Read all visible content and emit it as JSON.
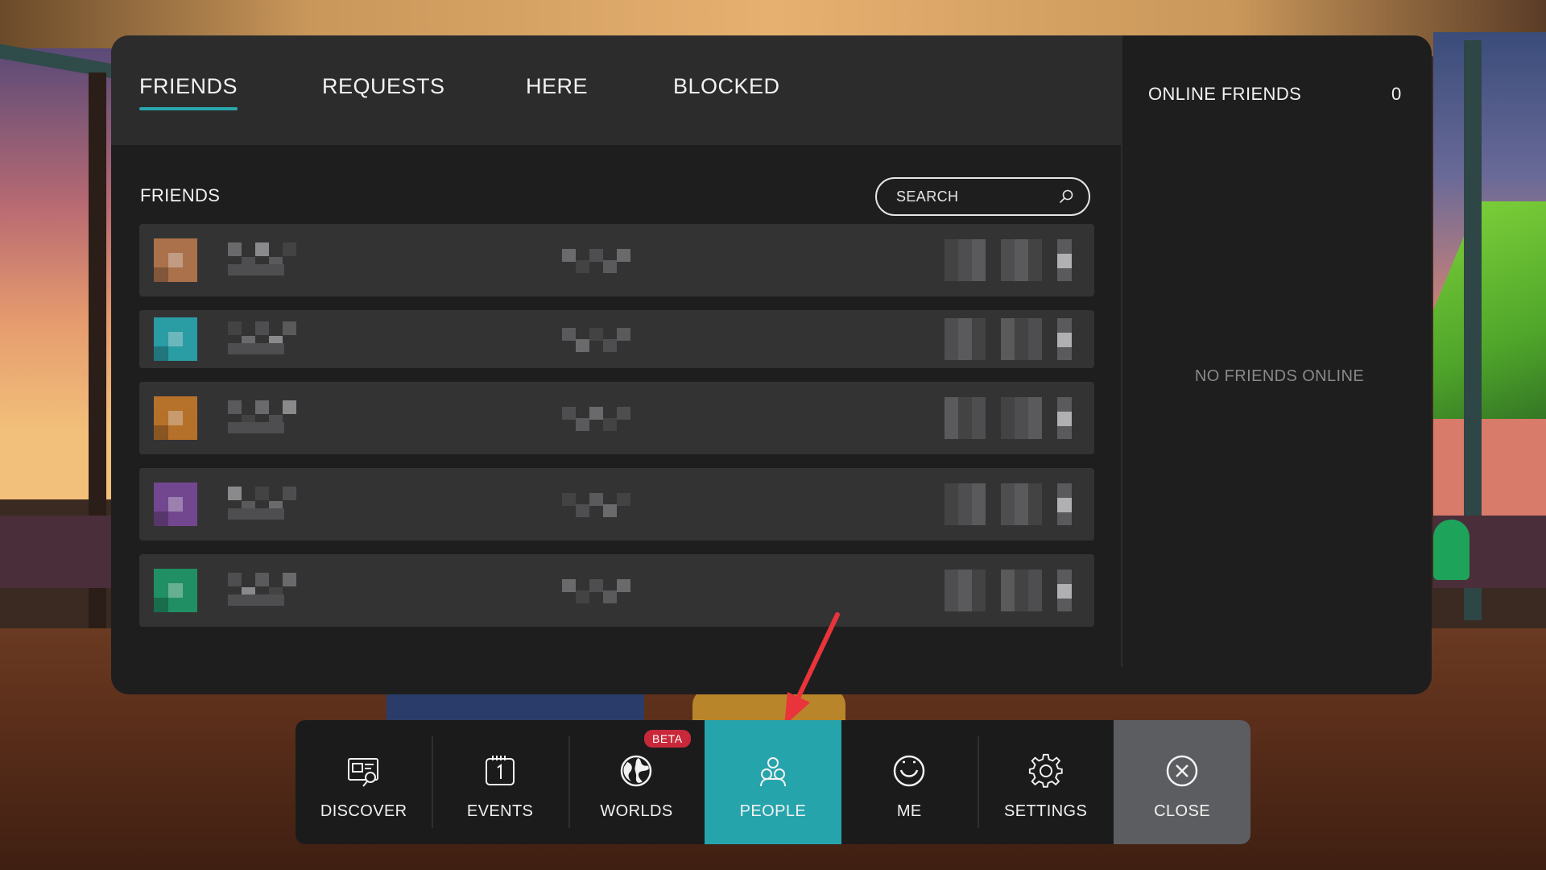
{
  "tabs": [
    {
      "label": "FRIENDS",
      "active": true
    },
    {
      "label": "REQUESTS",
      "active": false
    },
    {
      "label": "HERE",
      "active": false
    },
    {
      "label": "BLOCKED",
      "active": false
    }
  ],
  "friends_section": {
    "title": "FRIENDS",
    "search_placeholder": "SEARCH"
  },
  "friends_list": {
    "row_count": 5,
    "avatar_colors": [
      "#b8784e",
      "#2aa8b0",
      "#c4782a",
      "#7a4a9a",
      "#1f9a6a"
    ]
  },
  "online_panel": {
    "title": "ONLINE FRIENDS",
    "count": "0",
    "empty_message": "NO FRIENDS ONLINE"
  },
  "nav": {
    "items": [
      {
        "label": "DISCOVER",
        "icon": "discover-icon"
      },
      {
        "label": "EVENTS",
        "icon": "calendar-icon"
      },
      {
        "label": "WORLDS",
        "icon": "globe-icon",
        "badge": "BETA"
      },
      {
        "label": "PEOPLE",
        "icon": "people-icon",
        "active": true
      },
      {
        "label": "ME",
        "icon": "smiley-icon"
      },
      {
        "label": "SETTINGS",
        "icon": "gear-icon"
      },
      {
        "label": "CLOSE",
        "icon": "close-icon"
      }
    ]
  },
  "colors": {
    "accent": "#26a4ac",
    "panel": "#1e1e1f",
    "tabbar": "#2c2c2d",
    "beta_badge": "#c8283a",
    "annotation_arrow": "#e8343a"
  }
}
